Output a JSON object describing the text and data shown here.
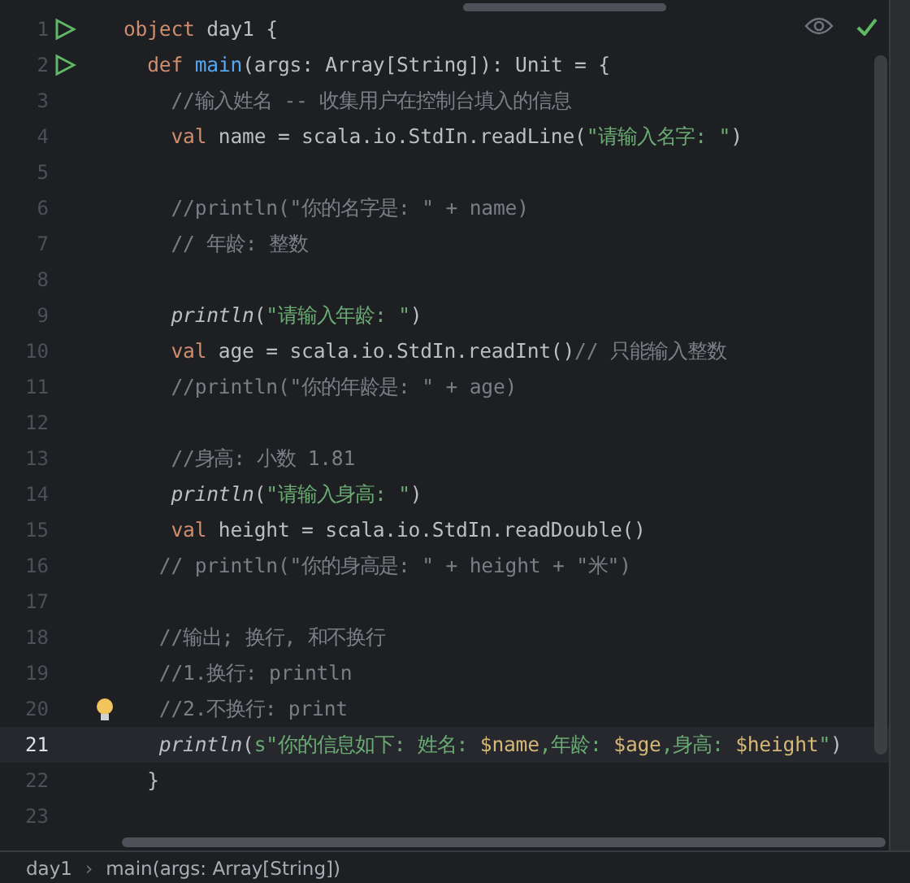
{
  "lines": [
    {
      "number": "1",
      "current": false,
      "runnable": true,
      "hint": false,
      "tokens": [
        {
          "kind": "kw",
          "text": "object"
        },
        {
          "kind": "plain",
          "text": " day1 {"
        }
      ]
    },
    {
      "number": "2",
      "current": false,
      "runnable": true,
      "hint": false,
      "tokens": [
        {
          "kind": "kw",
          "text": "  def"
        },
        {
          "kind": "fn",
          "text": " main"
        },
        {
          "kind": "plain",
          "text": "(args: Array[String]): Unit = {"
        }
      ]
    },
    {
      "number": "3",
      "current": false,
      "runnable": false,
      "hint": false,
      "tokens": [
        {
          "kind": "comment",
          "text": "    //输入姓名 -- 收集用户在控制台填入的信息"
        }
      ]
    },
    {
      "number": "4",
      "current": false,
      "runnable": false,
      "hint": false,
      "tokens": [
        {
          "kind": "kw",
          "text": "    val"
        },
        {
          "kind": "plain",
          "text": " name = scala.io.StdIn.readLine("
        },
        {
          "kind": "str",
          "text": "\"请输入名字: \""
        },
        {
          "kind": "plain",
          "text": ")"
        }
      ]
    },
    {
      "number": "5",
      "current": false,
      "runnable": false,
      "hint": false
    },
    {
      "number": "6",
      "current": false,
      "runnable": false,
      "hint": false,
      "tokens": [
        {
          "kind": "comment",
          "text": "    //println(\"你的名字是: \" + name)"
        }
      ]
    },
    {
      "number": "7",
      "current": false,
      "runnable": false,
      "hint": false,
      "tokens": [
        {
          "kind": "comment",
          "text": "    // 年龄: 整数"
        }
      ]
    },
    {
      "number": "8",
      "current": false,
      "runnable": false,
      "hint": false
    },
    {
      "number": "9",
      "current": false,
      "runnable": false,
      "hint": false,
      "tokens": [
        {
          "kind": "call",
          "text": "    println"
        },
        {
          "kind": "plain",
          "text": "("
        },
        {
          "kind": "str",
          "text": "\"请输入年龄: \""
        },
        {
          "kind": "plain",
          "text": ")"
        }
      ]
    },
    {
      "number": "10",
      "current": false,
      "runnable": false,
      "hint": false,
      "tokens": [
        {
          "kind": "kw",
          "text": "    val"
        },
        {
          "kind": "plain",
          "text": " age = scala.io.StdIn.readInt()"
        },
        {
          "kind": "comment",
          "text": "// 只能输入整数"
        }
      ]
    },
    {
      "number": "11",
      "current": false,
      "runnable": false,
      "hint": false,
      "tokens": [
        {
          "kind": "comment",
          "text": "    //println(\"你的年龄是: \" + age)"
        }
      ]
    },
    {
      "number": "12",
      "current": false,
      "runnable": false,
      "hint": false
    },
    {
      "number": "13",
      "current": false,
      "runnable": false,
      "hint": false,
      "tokens": [
        {
          "kind": "comment",
          "text": "    //身高: 小数 1.81"
        }
      ]
    },
    {
      "number": "14",
      "current": false,
      "runnable": false,
      "hint": false,
      "tokens": [
        {
          "kind": "call",
          "text": "    println"
        },
        {
          "kind": "plain",
          "text": "("
        },
        {
          "kind": "str",
          "text": "\"请输入身高: \""
        },
        {
          "kind": "plain",
          "text": ")"
        }
      ]
    },
    {
      "number": "15",
      "current": false,
      "runnable": false,
      "hint": false,
      "tokens": [
        {
          "kind": "kw",
          "text": "    val"
        },
        {
          "kind": "plain",
          "text": " height = scala.io.StdIn.readDouble()"
        }
      ]
    },
    {
      "number": "16",
      "current": false,
      "runnable": false,
      "hint": false,
      "tokens": [
        {
          "kind": "comment",
          "text": "   // println(\"你的身高是: \" + height + \"米\")"
        }
      ]
    },
    {
      "number": "17",
      "current": false,
      "runnable": false,
      "hint": false
    },
    {
      "number": "18",
      "current": false,
      "runnable": false,
      "hint": false,
      "tokens": [
        {
          "kind": "comment",
          "text": "   //输出; 换行, 和不换行"
        }
      ]
    },
    {
      "number": "19",
      "current": false,
      "runnable": false,
      "hint": false,
      "tokens": [
        {
          "kind": "comment",
          "text": "   //1.换行: println"
        }
      ]
    },
    {
      "number": "20",
      "current": false,
      "runnable": false,
      "hint": true,
      "tokens": [
        {
          "kind": "comment",
          "text": "   //2.不换行: print"
        }
      ]
    },
    {
      "number": "21",
      "current": true,
      "runnable": false,
      "hint": false,
      "tokens": [
        {
          "kind": "call",
          "text": "   println"
        },
        {
          "kind": "plain",
          "text": "("
        },
        {
          "kind": "str",
          "text": "s\"你的信息如下: 姓名: "
        },
        {
          "kind": "interp",
          "text": "$name"
        },
        {
          "kind": "str",
          "text": ",年龄: "
        },
        {
          "kind": "interp",
          "text": "$age"
        },
        {
          "kind": "str",
          "text": ",身高: "
        },
        {
          "kind": "interp",
          "text": "$height"
        },
        {
          "kind": "str",
          "text": "\""
        },
        {
          "kind": "plain",
          "text": ")"
        }
      ]
    },
    {
      "number": "22",
      "current": false,
      "runnable": false,
      "hint": false,
      "tokens": [
        {
          "kind": "plain",
          "text": "  }"
        }
      ]
    },
    {
      "number": "23",
      "current": false,
      "runnable": false,
      "hint": false
    }
  ],
  "breadcrumbs": [
    "day1",
    "main(args: Array[String])"
  ],
  "breadcrumb_separator": "›"
}
